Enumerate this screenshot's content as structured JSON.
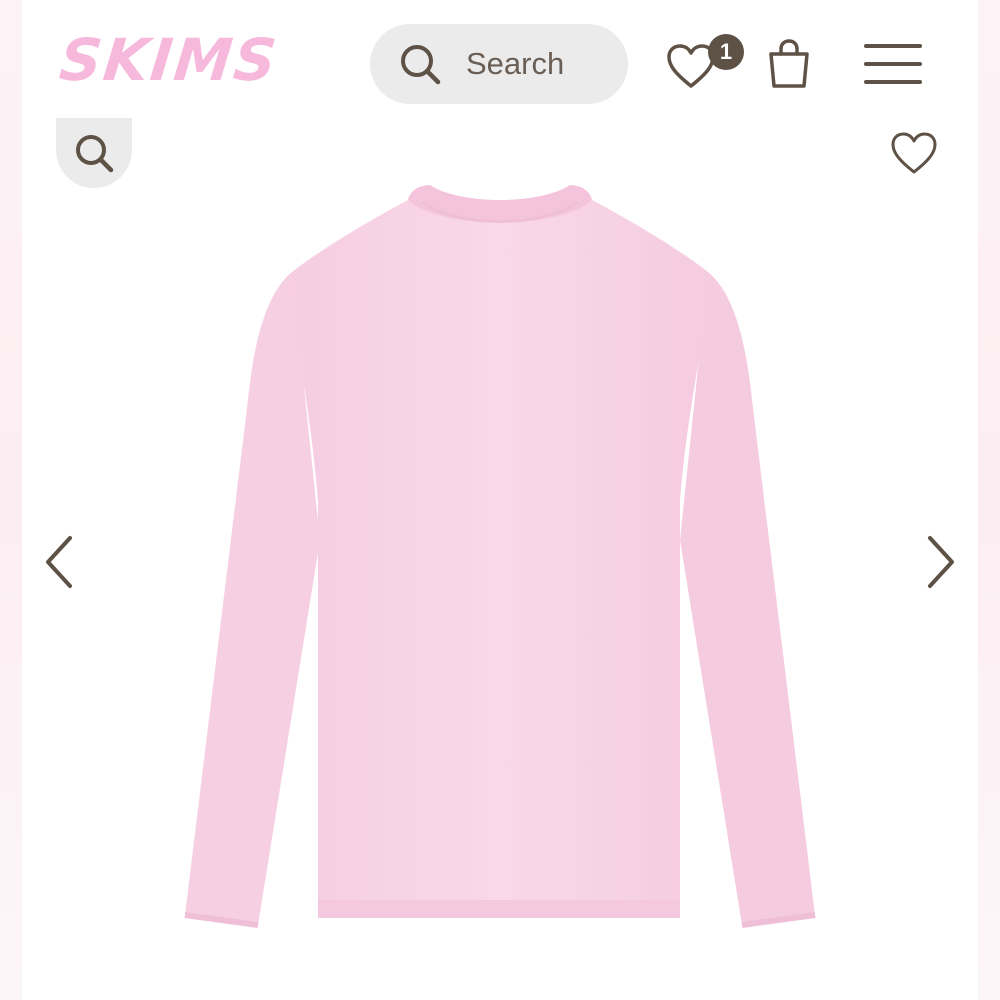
{
  "header": {
    "logo_text": "SKIMS",
    "search": {
      "placeholder": "Search"
    },
    "wishlist_count": "1"
  },
  "icons": {
    "search": "search-icon",
    "wishlist": "heart-icon",
    "bag": "shopping-bag-icon",
    "menu": "hamburger-menu-icon",
    "zoom": "zoom-icon",
    "favorite": "heart-outline-icon",
    "previous": "chevron-left-icon",
    "next": "chevron-right-icon"
  },
  "colors": {
    "brand_pink": "#f6b9dc",
    "icon_brown": "#5e5146",
    "pill_gray": "#ebebeb",
    "garment_pink": "#f8d3e6"
  }
}
